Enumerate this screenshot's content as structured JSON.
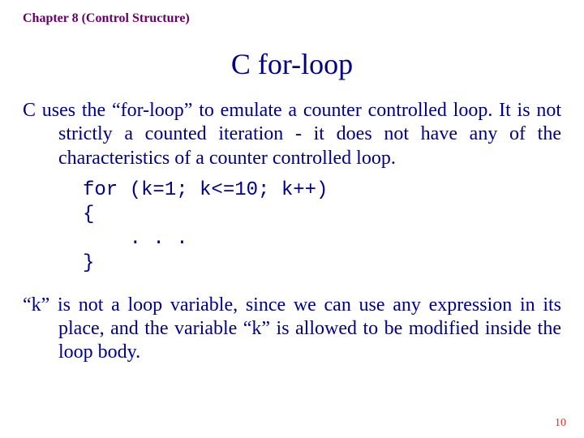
{
  "header": {
    "chapter": "Chapter 8 (Control Structure)"
  },
  "title": "C  for-loop",
  "body": {
    "p1": "C   uses the “for-loop”  to emulate a counter controlled loop.  It is not strictly a counted iteration - it does not have any of the characteristics of a counter controlled loop.",
    "code": "for (k=1; k<=10; k++)\n{\n    . . .\n}",
    "p2": "“k”  is not a loop variable, since we can use any expression in its place, and the variable “k”  is allowed to be modified inside the loop body."
  },
  "page_number": "10"
}
